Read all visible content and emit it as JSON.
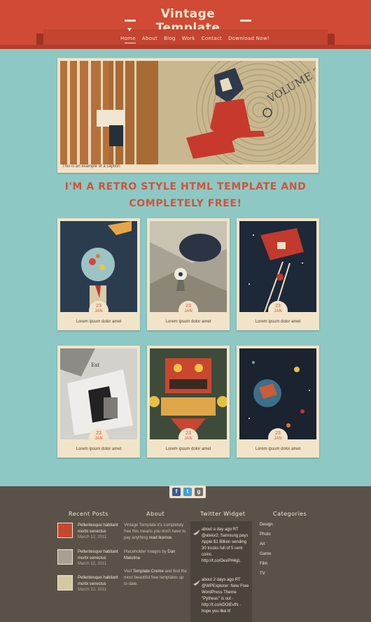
{
  "header": {
    "site_title": "Vintage Template",
    "nav": [
      "Home",
      "About",
      "Blog",
      "Work",
      "Contact",
      "Download Now!"
    ],
    "colors": {
      "brand": "#d04a36",
      "cream": "#f6e8cf",
      "background": "#8ec8c4"
    }
  },
  "hero": {
    "caption": "This is an example of a caption",
    "art_text": "VOLUME 2"
  },
  "tagline": {
    "line1": "I'm a retro style HTML template and",
    "line2": "completely free!"
  },
  "cards": [
    {
      "day": "23",
      "month": "JAN",
      "caption": "Lorem ipsum dolor amet"
    },
    {
      "day": "23",
      "month": "JAN",
      "caption": "Lorem ipsum dolor amet"
    },
    {
      "day": "23",
      "month": "JAN",
      "caption": "Lorem ipsum dolor amet"
    },
    {
      "day": "23",
      "month": "JAN",
      "caption": "Lorem ipsum dolor amet"
    },
    {
      "day": "23",
      "month": "JAN",
      "caption": "Lorem ipsum dolor amet"
    },
    {
      "day": "23",
      "month": "JAN",
      "caption": "Lorem ipsum dolor amet"
    }
  ],
  "footer": {
    "social": [
      "facebook-icon",
      "twitter-icon",
      "google-plus-icon"
    ],
    "recent_posts": {
      "title": "Recent Posts",
      "items": [
        {
          "title": "Pellentesque habitant morbi senectus",
          "date": "March 12, 2011"
        },
        {
          "title": "Pellentesque habitant morbi senectus",
          "date": "March 12, 2011"
        },
        {
          "title": "Pellentesque habitant morbi senectus",
          "date": "March 12, 2011"
        }
      ]
    },
    "about": {
      "title": "About",
      "p1_pre": "Vintage Template it's completely free this means you don't have to pay anything ",
      "p1_link": "read license",
      "p1_post": ".",
      "p2_pre": "Placeholder images by ",
      "p2_link": "Dan Matutina",
      "p3_pre": "Visit ",
      "p3_link": "Template Creme",
      "p3_post": " and find the most beautiful free templates up to date."
    },
    "twitter": {
      "title": "Twitter Widget",
      "tweets": [
        {
          "time": "about a day ago",
          "text": "RT @alxex2: Samsung pays Apple $1 Billion sending 30 trucks full of 5 cent coins http://t.co/OexPH4gL"
        },
        {
          "time": "about 2 days ago",
          "text": "RT @WPExplorer: New Free WordPress Theme \"Pytheas\" is out - http://t.co/kDOlEvlN - hope you like it!"
        }
      ]
    },
    "categories": {
      "title": "Categories",
      "items": [
        "Design",
        "Photo",
        "Art",
        "Game",
        "Film",
        "TV"
      ]
    }
  }
}
